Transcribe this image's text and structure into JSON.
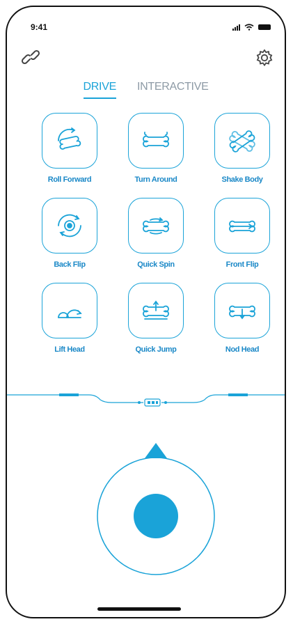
{
  "status_bar": {
    "time": "9:41"
  },
  "tabs": [
    {
      "label": "DRIVE",
      "active": true
    },
    {
      "label": "INTERACTIVE",
      "active": false
    }
  ],
  "actions": [
    {
      "label": "Roll Forward",
      "icon": "roll-forward-icon"
    },
    {
      "label": "Turn Around",
      "icon": "turn-around-icon"
    },
    {
      "label": "Shake Body",
      "icon": "shake-body-icon"
    },
    {
      "label": "Back Flip",
      "icon": "back-flip-icon"
    },
    {
      "label": "Quick Spin",
      "icon": "quick-spin-icon"
    },
    {
      "label": "Front Flip",
      "icon": "front-flip-icon"
    },
    {
      "label": "Lift Head",
      "icon": "lift-head-icon"
    },
    {
      "label": "Quick Jump",
      "icon": "quick-jump-icon"
    },
    {
      "label": "Nod Head",
      "icon": "nod-head-icon"
    }
  ],
  "colors": {
    "accent": "#1aa3d8",
    "label": "#1a88c7",
    "inactive": "#8d9aa5"
  }
}
